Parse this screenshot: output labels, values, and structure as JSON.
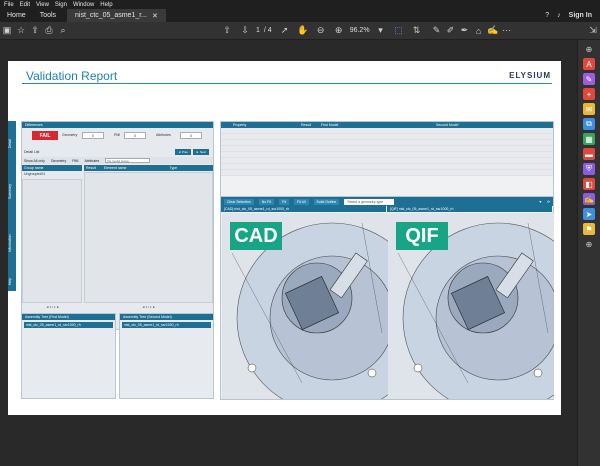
{
  "menu": [
    "File",
    "Edit",
    "View",
    "Sign",
    "Window",
    "Help"
  ],
  "tabs": {
    "home": "Home",
    "tools": "Tools",
    "doc": "nist_ctc_05_asme1_r...",
    "sign_in": "Sign In"
  },
  "toolbar": {
    "page_current": "1",
    "page_total": "/ 4",
    "zoom": "96.2%"
  },
  "report": {
    "title": "Validation Report",
    "logo": "ELYSIUM",
    "side_tabs": [
      "Detail",
      "Summary",
      "Information",
      "Help"
    ],
    "differences_label": "Differences",
    "fail": "FAIL",
    "geometry_label": "Geometry",
    "geometry_value": "0",
    "pmi_label": "PMI",
    "pmi_value": "0",
    "attributes_label": "Attributes",
    "attributes_value": "0",
    "detail_list": "Detail List",
    "prev": "◄ Prev",
    "next": "► Next",
    "show_all": "Show All only",
    "geometry": "Geometry",
    "pmi": "PMI",
    "attributes": "Attributes",
    "no_model": "No model status",
    "col_group": "Group name",
    "col_result": "Result",
    "col_element": "Element name",
    "col_type": "Type",
    "group_row": "Ungrouped01",
    "pager_left": "◄ 1 / 1 ►",
    "pager_right": "◄ 1 / 1 ►",
    "asm_first": "Assembly Tree (First Model)",
    "asm_second": "Assembly Tree (Second Model)",
    "asm_first_item": "nist_ctc_05_asme1_rd_ssr1000_rh",
    "asm_second_item": "nist_ctc_05_asme1_rd_ssr1000_rh",
    "prop_cols": [
      "Property",
      "Result",
      "First Model",
      "Second Model"
    ],
    "viz_buttons": {
      "clear": "Clear Selection",
      "nofit": "No Fit",
      "fit": "Fit",
      "fitall": "Fit All",
      "solid": "Solid Outline",
      "geom": "Select a geometry type"
    },
    "viz_left": "[CAD] nist_ctc_05_asme1_rd_ssr1000_rh",
    "viz_right": "[QIF] nist_ctc_05_asme1_rd_ssr1000_rh",
    "cad": "CAD",
    "qif": "QIF"
  },
  "colors": {
    "accent": "#1e6f94",
    "fail": "#d7282f",
    "badge": "#18a586"
  }
}
